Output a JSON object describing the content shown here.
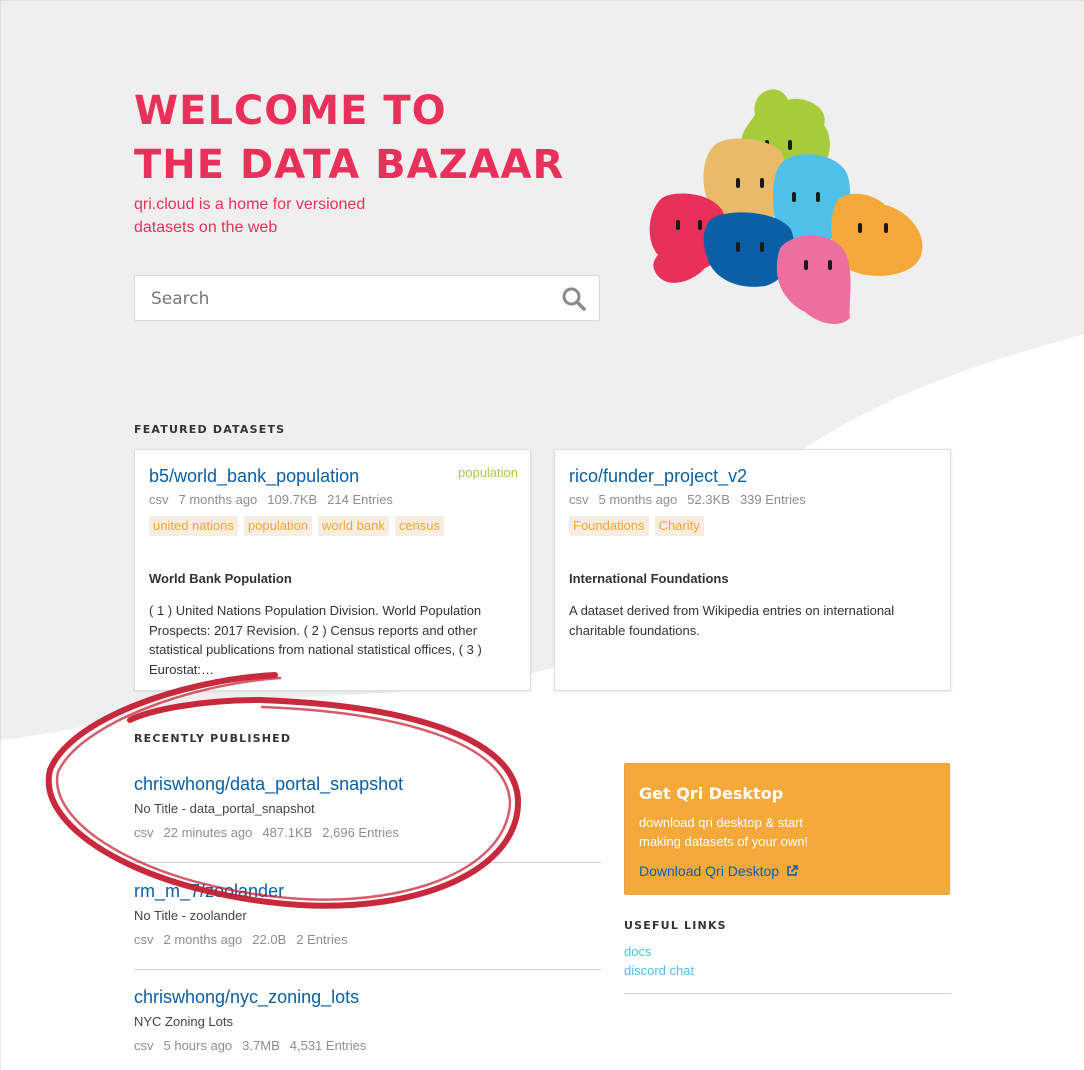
{
  "hero": {
    "title_line1": "WELCOME TO",
    "title_line2": "THE DATA BAZAAR",
    "subtitle_line1": "qri.cloud is a home for versioned",
    "subtitle_line2": "datasets on the web"
  },
  "search": {
    "placeholder": "Search",
    "value": ""
  },
  "featured": {
    "label": "FEATURED DATASETS",
    "cards": [
      {
        "name": "b5/world_bank_population",
        "badge": "population",
        "format": "csv",
        "updated": "7 months ago",
        "size": "109.7KB",
        "entries": "214 Entries",
        "tags": [
          "united nations",
          "population",
          "world bank",
          "census"
        ],
        "title": "World Bank Population",
        "description": "( 1 ) United Nations Population Division. World Population Prospects: 2017 Revision. ( 2 ) Census reports and other statistical publications from national statistical offices, ( 3 ) Eurostat:…"
      },
      {
        "name": "rico/funder_project_v2",
        "badge": "",
        "format": "csv",
        "updated": "5 months ago",
        "size": "52.3KB",
        "entries": "339 Entries",
        "tags": [
          "Foundations",
          "Charity"
        ],
        "title": "International Foundations",
        "description": "A dataset derived from Wikipedia entries on international charitable foundations."
      }
    ]
  },
  "recent": {
    "label": "RECENTLY PUBLISHED",
    "items": [
      {
        "name": "chriswhong/data_portal_snapshot",
        "title": "No Title - data_portal_snapshot",
        "format": "csv",
        "updated": "22 minutes ago",
        "size": "487.1KB",
        "entries": "2,696 Entries"
      },
      {
        "name": "rm_m_7/zoolander",
        "title": "No Title - zoolander",
        "format": "csv",
        "updated": "2 months ago",
        "size": "22.0B",
        "entries": "2 Entries"
      },
      {
        "name": "chriswhong/nyc_zoning_lots",
        "title": "NYC Zoning Lots",
        "format": "csv",
        "updated": "5 hours ago",
        "size": "3.7MB",
        "entries": "4,531 Entries"
      }
    ]
  },
  "promo": {
    "title": "Get Qri Desktop",
    "text": "download qri desktop & start making datasets of your own!",
    "link": "Download Qri Desktop"
  },
  "useful_links": {
    "label": "USEFUL LINKS",
    "items": [
      "docs",
      "discord chat"
    ]
  },
  "colors": {
    "brand_red": "#e8305a",
    "link_blue": "#0b5fa5",
    "tag_orange": "#f2a33b",
    "badge_green": "#a6cc3b",
    "promo_orange": "#f6a93b",
    "useful_link_cyan": "#4fc1e9",
    "annotation_red": "#c4172c"
  },
  "icons": {
    "search": "magnifier-icon",
    "external": "external-link-icon"
  }
}
